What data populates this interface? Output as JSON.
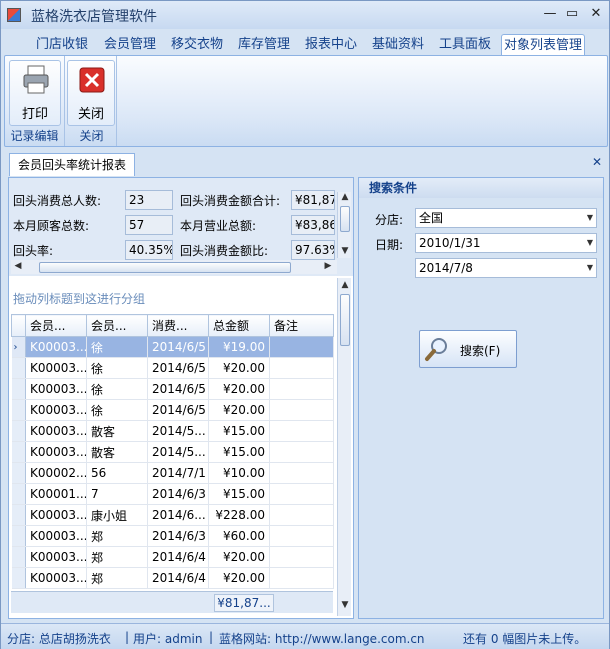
{
  "window": {
    "title": "蓝格洗衣店管理软件"
  },
  "ribbon_tabs": [
    "门店收银",
    "会员管理",
    "移交衣物",
    "库存管理",
    "报表中心",
    "基础资料",
    "工具面板",
    "对象列表管理"
  ],
  "ribbon": {
    "groups": [
      {
        "label": "记录编辑",
        "button": "打印",
        "icon": "printer-icon"
      },
      {
        "label": "关闭",
        "button": "关闭",
        "icon": "close-x-icon"
      }
    ]
  },
  "doc_tab": "会员回头率统计报表",
  "stats": {
    "returning_count_label": "回头消费总人数:",
    "returning_count": "23",
    "returning_total_label": "回头消费金额合计:",
    "returning_total": "¥81,87",
    "month_customers_label": "本月顾客总数:",
    "month_customers": "57",
    "month_revenue_label": "本月营业总额:",
    "month_revenue": "¥83,86",
    "return_rate_label": "回头率:",
    "return_rate": "40.35%",
    "amount_ratio_label": "回头消费金额比:",
    "amount_ratio": "97.63%"
  },
  "grid": {
    "group_hint": "拖动列标题到这进行分组",
    "columns": [
      "会员...",
      "会员...",
      "消费...",
      "总金额",
      "备注"
    ],
    "rows": [
      [
        "K00003...",
        "徐",
        "2014/6/5",
        "¥19.00",
        ""
      ],
      [
        "K00003...",
        "徐",
        "2014/6/5",
        "¥20.00",
        ""
      ],
      [
        "K00003...",
        "徐",
        "2014/6/5",
        "¥20.00",
        ""
      ],
      [
        "K00003...",
        "徐",
        "2014/6/5",
        "¥20.00",
        ""
      ],
      [
        "K00003...",
        "散客",
        "2014/5...",
        "¥15.00",
        ""
      ],
      [
        "K00003...",
        "散客",
        "2014/5...",
        "¥15.00",
        ""
      ],
      [
        "K00002...",
        "56",
        "2014/7/1",
        "¥10.00",
        ""
      ],
      [
        "K00001...",
        "7",
        "2014/6/3",
        "¥15.00",
        ""
      ],
      [
        "K00003...",
        "康小姐",
        "2014/6...",
        "¥228.00",
        ""
      ],
      [
        "K00003...",
        "郑",
        "2014/6/3",
        "¥60.00",
        ""
      ],
      [
        "K00003...",
        "郑",
        "2014/6/4",
        "¥20.00",
        ""
      ],
      [
        "K00003...",
        "郑",
        "2014/6/4",
        "¥20.00",
        ""
      ]
    ],
    "total": "¥81,87..."
  },
  "search": {
    "title": "搜索条件",
    "branch_label": "分店:",
    "branch_value": "全国",
    "date_label": "日期:",
    "date_from": "2010/1/31",
    "date_to": "2014/7/8",
    "search_button": "搜索(F)"
  },
  "status": {
    "branch": "分店: 总店胡扬洗衣",
    "user": "用户: admin",
    "site": "蓝格网站: http://www.lange.com.cn",
    "upload": "还有 0 幅图片未上传。"
  }
}
